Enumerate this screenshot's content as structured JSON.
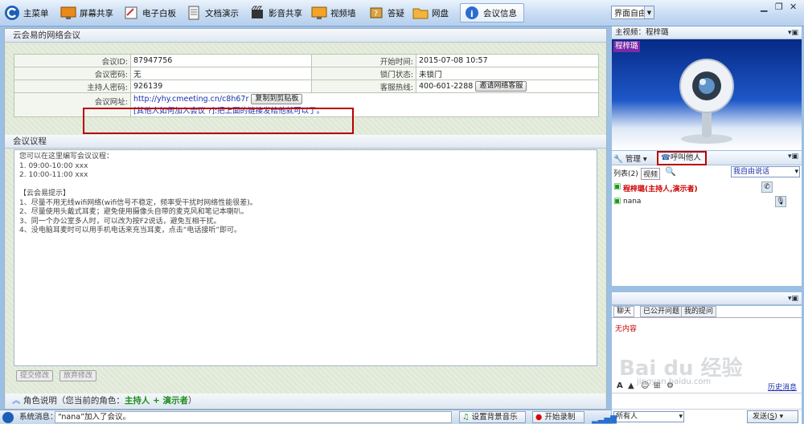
{
  "toolbar": {
    "main_menu": "主菜单",
    "screen_share": "屏幕共享",
    "whiteboard": "电子白板",
    "doc_present": "文档演示",
    "media_share": "影音共享",
    "video_wall": "视频墙",
    "qa": "答疑",
    "netdisk": "网盘",
    "meeting_info": "会议信息",
    "mode_value": "界面自由"
  },
  "info": {
    "section_title": "云会易的网络会议",
    "meeting_id_label": "会议ID:",
    "meeting_id": "87947756",
    "start_time_label": "开始时间:",
    "start_time": "2015-07-08 10:57",
    "password_label": "会议密码:",
    "password": "无",
    "lock_label": "锁门状态:",
    "lock_status": "未锁门",
    "host_pw_label": "主持人密码:",
    "host_pw": "926139",
    "hotline_label": "客服热线:",
    "hotline": "400-601-2288",
    "invite_service_btn": "邀请网络客服",
    "url_label": "会议网址:",
    "url": "http://yhy.cmeeting.cn/c8h67r",
    "copy_btn": "复制到剪贴板",
    "url_hint": "[其他人如何加入会议 ?]:把上面的链接发给他就可以了。"
  },
  "agenda": {
    "section_title": "会议议程",
    "text": "您可以在这里编写会议议程：\n1. 09:00-10:00 xxx\n2. 10:00-11:00 xxx\n\n【云会易提示】\n1、尽量不用无线wifi网络(wifi信号不稳定，频率受干扰时网络性能很差)。\n2、尽量使用头戴式耳麦；避免使用摄像头自带的麦克风和笔记本喇叭。\n3、同一个办公室多人时，可以改为按F2说话，避免互相干扰。\n4、没电脑耳麦时可以用手机电话来充当耳麦，点击“电话接听”即可。",
    "submit_btn": "提交修改",
    "discard_btn": "放弃修改"
  },
  "role": {
    "prefix": "角色说明（您当前的角色：",
    "value": "主持人 + 演示者",
    "suffix": "）"
  },
  "video": {
    "header": "主视频：程梓璐",
    "label": "程梓璐"
  },
  "members": {
    "manage_btn": "管理",
    "call_btn": "呼叫他人",
    "list_tab": "列表",
    "list_count": "(2)",
    "video_tab": "视频",
    "speak_mode": "我自由说话",
    "host_name": "程梓璐(主持人,演示者)",
    "other_name": "nana"
  },
  "chat": {
    "tab_chat": "聊天",
    "tab_public": "已公开问题",
    "tab_mine": "我的提问",
    "empty": "无内容",
    "history": "历史消息",
    "target": "所有人",
    "send_btn": "发送(",
    "send_key": "S",
    "send_btn_end": ")"
  },
  "status": {
    "prefix": "系统消息：",
    "message": "“nana”加入了会议。",
    "bg_music_btn": "设置背景音乐",
    "record_btn": "开始录制"
  },
  "watermark": {
    "logo": "Bai du 经验",
    "url": "jingyan.baidu.com"
  }
}
